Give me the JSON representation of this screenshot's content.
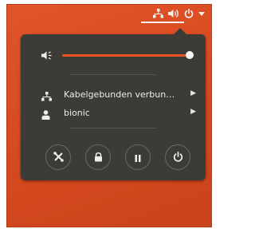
{
  "tray": {
    "icons": [
      "network-icon",
      "volume-icon",
      "power-icon",
      "menu-arrow-icon"
    ]
  },
  "volume": {
    "icon": "volume-icon",
    "level": 1.0
  },
  "menu": {
    "items": [
      {
        "icon": "network-wired-icon",
        "label": "Kabelgebunden verbun…"
      },
      {
        "icon": "user-icon",
        "label": "bionic"
      }
    ]
  },
  "actions": [
    "settings-button",
    "lock-button",
    "suspend-button",
    "power-off-button"
  ],
  "colors": {
    "accent": "#e95420",
    "menu_bg": "#3c3b37",
    "desktop": "#d94a1f",
    "text": "#ececec"
  }
}
